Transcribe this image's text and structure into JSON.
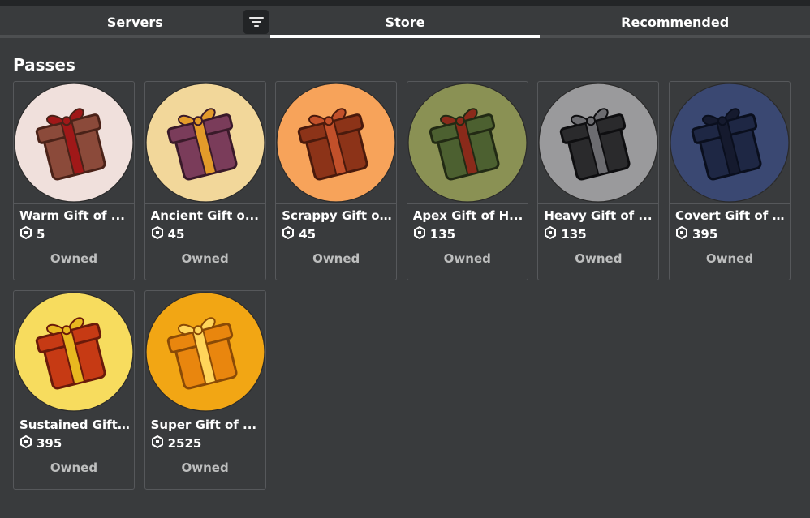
{
  "tabs": [
    {
      "label": "Servers",
      "active": false
    },
    {
      "label": "Store",
      "active": true
    },
    {
      "label": "Recommended",
      "active": false
    }
  ],
  "filter_icon": "filter-lines-icon",
  "section_title": "Passes",
  "currency_icon": "robux-icon",
  "passes": [
    {
      "name": "Warm Gift of ...",
      "price": "5",
      "status": "Owned",
      "icon": "brown-gift-icon",
      "bg": "#f0e0dc",
      "box": "#8b4a3a",
      "dark": "#4a2218",
      "ribbon": "#a01818"
    },
    {
      "name": "Ancient Gift o...",
      "price": "45",
      "status": "Owned",
      "icon": "ancient-gift-icon",
      "bg": "#f2d79a",
      "box": "#7a3c5a",
      "dark": "#3a1a2a",
      "ribbon": "#e39b2a"
    },
    {
      "name": "Scrappy Gift o...",
      "price": "45",
      "status": "Owned",
      "icon": "scrappy-gift-icon",
      "bg": "#f7a35a",
      "box": "#8c3318",
      "dark": "#4a1a0c",
      "ribbon": "#c2502a"
    },
    {
      "name": "Apex Gift of H...",
      "price": "135",
      "status": "Owned",
      "icon": "camo-gift-icon",
      "bg": "#8a9154",
      "box": "#4c6030",
      "dark": "#222a14",
      "ribbon": "#8a2a1a"
    },
    {
      "name": "Heavy Gift of ...",
      "price": "135",
      "status": "Owned",
      "icon": "black-gift-icon",
      "bg": "#9a9a9c",
      "box": "#2a2a2c",
      "dark": "#0e0e10",
      "ribbon": "#6c6c70"
    },
    {
      "name": "Covert Gift of ...",
      "price": "395",
      "status": "Owned",
      "icon": "covert-gift-icon",
      "bg": "#3a4872",
      "box": "#1e2744",
      "dark": "#0a0f1e",
      "ribbon": "#151a2e"
    },
    {
      "name": "Sustained Gift...",
      "price": "395",
      "status": "Owned",
      "icon": "cylinder-gift-icon",
      "bg": "#f7dc5e",
      "box": "#c63a14",
      "dark": "#6a1a0a",
      "ribbon": "#e8b820"
    },
    {
      "name": "Super Gift of ...",
      "price": "2525",
      "status": "Owned",
      "icon": "gold-gift-icon",
      "bg": "#f2a614",
      "box": "#e9860e",
      "dark": "#8a4a06",
      "ribbon": "#ffd55a"
    }
  ]
}
